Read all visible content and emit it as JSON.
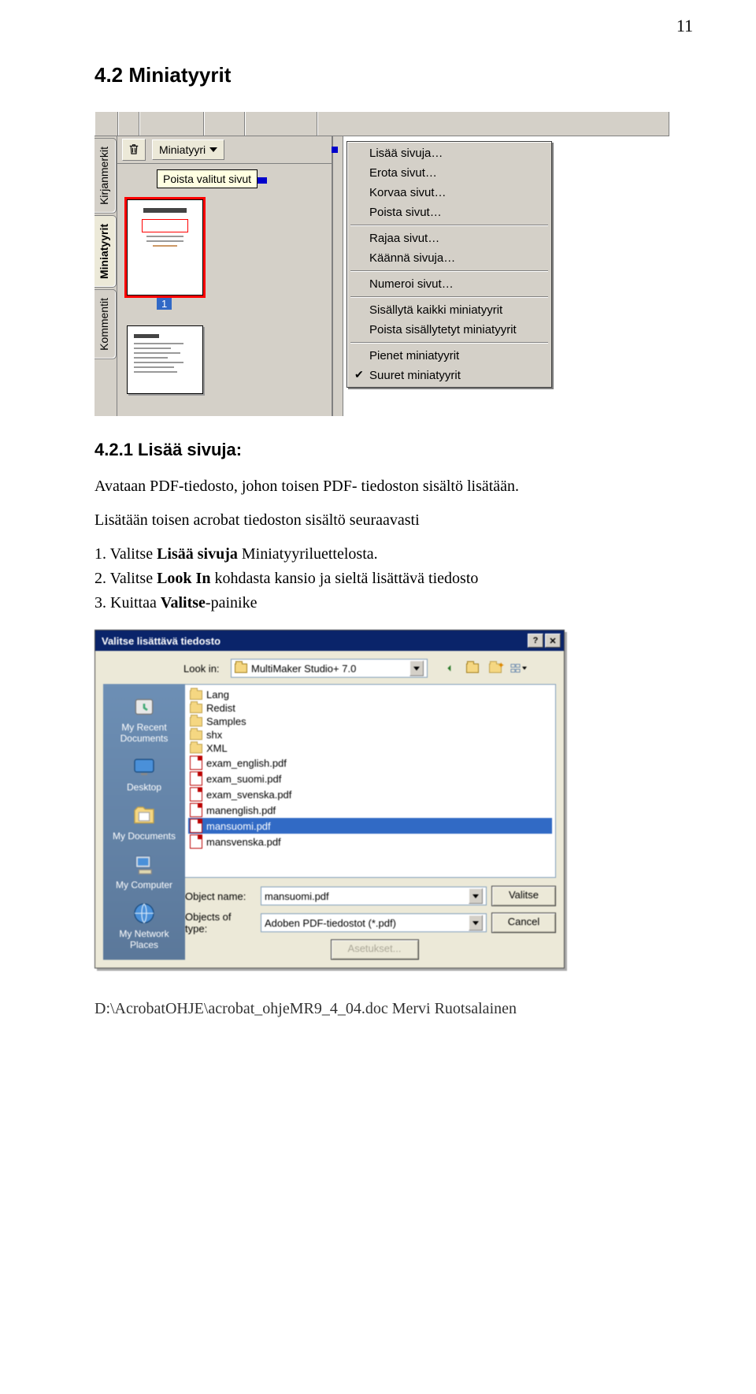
{
  "page_number": "11",
  "section_title": "4.2 Miniatyyrit",
  "subsection_title": "4.2.1 Lisää sivuja:",
  "intro_para": "Avataan PDF-tiedosto, johon toisen PDF- tiedoston sisältö lisätään.",
  "steps_intro": "Lisätään toisen acrobat tiedoston sisältö seuraavasti",
  "step1_pre": "1. Valitse ",
  "step1_bold": "Lisää sivuja",
  "step1_post": " Miniatyyriluettelosta.",
  "step2_pre": "2. Valitse ",
  "step2_bold": "Look In",
  "step2_post": " kohdasta kansio ja sieltä lisättävä tiedosto",
  "step3_pre": "3. Kuittaa ",
  "step3_bold": "Valitse",
  "step3_post": "-painike",
  "footer": "D:\\AcrobatOHJE\\acrobat_ohjeMR9_4_04.doc Mervi Ruotsalainen",
  "shot1": {
    "vtabs": {
      "bookmarks": "Kirjanmerkit",
      "thumbs": "Miniatyyrit",
      "comments": "Kommentit"
    },
    "miniatyyri_btn": "Miniatyyri",
    "tooltip": "Poista valitut sivut",
    "thumb1_num": "1",
    "menu": {
      "add_pages": "Lisää sivuja…",
      "extract_pages": "Erota sivut…",
      "replace_pages": "Korvaa sivut…",
      "delete_pages": "Poista sivut…",
      "crop_pages": "Rajaa sivut…",
      "rotate_pages": "Käännä sivuja…",
      "number_pages": "Numeroi sivut…",
      "embed_all": "Sisällytä kaikki miniatyyrit",
      "remove_embedded": "Poista sisällytetyt miniatyyrit",
      "small": "Pienet miniatyyrit",
      "large": "Suuret miniatyyrit"
    }
  },
  "shot2": {
    "title": "Valitse lisättävä tiedosto",
    "lookin_label": "Look in:",
    "lookin_value": "MultiMaker Studio+ 7.0",
    "places": {
      "recent": "My Recent Documents",
      "desktop": "Desktop",
      "mydocs": "My Documents",
      "mycomp": "My Computer",
      "mynet": "My Network Places"
    },
    "files": {
      "lang": "Lang",
      "redist": "Redist",
      "samples": "Samples",
      "shx": "shx",
      "xml": "XML",
      "exam_en": "exam_english.pdf",
      "exam_fi": "exam_suomi.pdf",
      "exam_sv": "exam_svenska.pdf",
      "man_en": "manenglish.pdf",
      "man_fi": "mansuomi.pdf",
      "man_sv": "mansvenska.pdf"
    },
    "obj_name_label": "Object name:",
    "obj_name_value": "mansuomi.pdf",
    "obj_type_label": "Objects of type:",
    "obj_type_value": "Adoben PDF-tiedostot (*.pdf)",
    "btn_ok": "Valitse",
    "btn_cancel": "Cancel",
    "btn_settings": "Asetukset..."
  }
}
